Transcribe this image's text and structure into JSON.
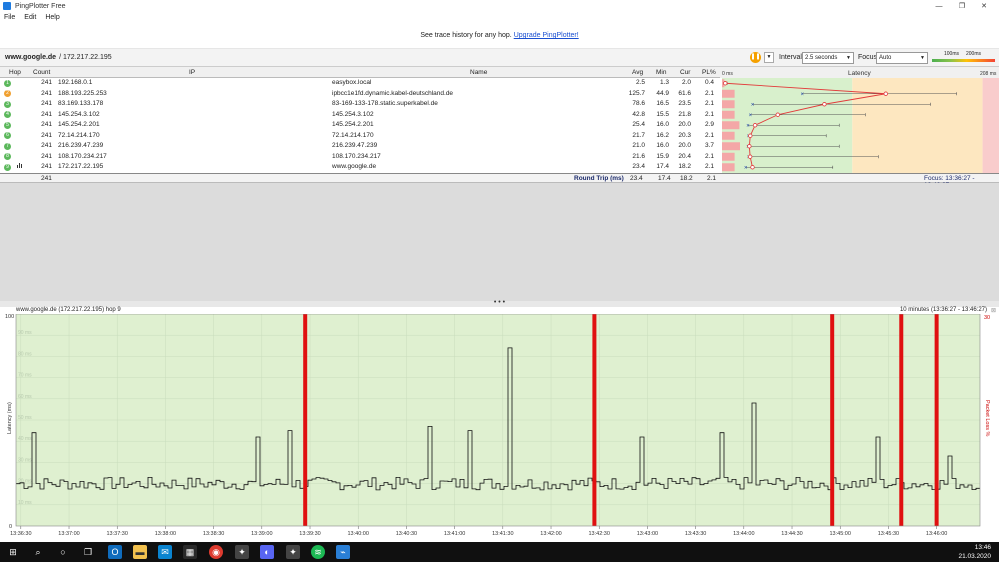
{
  "window": {
    "title": "PingPlotter Free",
    "minimize": "—",
    "maximize": "❐",
    "close": "✕"
  },
  "menu": [
    "File",
    "Edit",
    "Help"
  ],
  "banner": {
    "text": "See trace history for any hop.",
    "link": "Upgrade PingPlotter!"
  },
  "target": {
    "host": "www.google.de",
    "ip": "/ 172.217.22.195"
  },
  "controls": {
    "interval_label": "Interval",
    "interval_value": "2.5 seconds",
    "focus_label": "Focus",
    "focus_value": "Auto",
    "scale_100": "100ms",
    "scale_200": "200ms"
  },
  "table": {
    "headers": {
      "hop": "Hop",
      "count": "Count",
      "ip": "IP",
      "name": "Name",
      "avg": "Avg",
      "min": "Min",
      "cur": "Cur",
      "pl": "PL%",
      "latency": "Latency",
      "lat_min": "0 ms",
      "lat_max": "208 ms"
    },
    "rows": [
      {
        "hop": "1",
        "count": "241",
        "ip": "192.168.0.1",
        "name": "easybox.local",
        "avg": "2.5",
        "min": "1.3",
        "cur": "2.0",
        "pl": "0.4",
        "badge": "green"
      },
      {
        "hop": "2",
        "count": "241",
        "ip": "188.193.225.253",
        "name": "ipbcc1e1fd.dynamic.kabel-deutschland.de",
        "avg": "125.7",
        "min": "44.9",
        "cur": "61.6",
        "pl": "2.1",
        "badge": "orange"
      },
      {
        "hop": "3",
        "count": "241",
        "ip": "83.169.133.178",
        "name": "83-169-133-178.static.superkabel.de",
        "avg": "78.6",
        "min": "16.5",
        "cur": "23.5",
        "pl": "2.1",
        "badge": "green"
      },
      {
        "hop": "4",
        "count": "241",
        "ip": "145.254.3.102",
        "name": "145.254.3.102",
        "avg": "42.8",
        "min": "15.5",
        "cur": "21.8",
        "pl": "2.1",
        "badge": "green"
      },
      {
        "hop": "5",
        "count": "241",
        "ip": "145.254.2.201",
        "name": "145.254.2.201",
        "avg": "25.4",
        "min": "16.0",
        "cur": "20.0",
        "pl": "2.9",
        "badge": "green"
      },
      {
        "hop": "6",
        "count": "241",
        "ip": "72.14.214.170",
        "name": "72.14.214.170",
        "avg": "21.7",
        "min": "16.2",
        "cur": "20.3",
        "pl": "2.1",
        "badge": "green"
      },
      {
        "hop": "7",
        "count": "241",
        "ip": "216.239.47.239",
        "name": "216.239.47.239",
        "avg": "21.0",
        "min": "16.0",
        "cur": "20.0",
        "pl": "3.7",
        "badge": "green"
      },
      {
        "hop": "8",
        "count": "241",
        "ip": "108.170.234.217",
        "name": "108.170.234.217",
        "avg": "21.6",
        "min": "15.9",
        "cur": "20.4",
        "pl": "2.1",
        "badge": "green"
      },
      {
        "hop": "9",
        "count": "241",
        "ip": "172.217.22.195",
        "name": "www.google.de",
        "avg": "23.4",
        "min": "17.4",
        "cur": "18.2",
        "pl": "2.1",
        "badge": "green"
      }
    ],
    "total": {
      "count": "241",
      "label": "Round Trip (ms)",
      "avg": "23.4",
      "min": "17.4",
      "cur": "18.2",
      "pl": "2.1",
      "focus": "Focus: 13:36:27 - 13:46:27"
    }
  },
  "splitter": "• • •",
  "graph": {
    "title": "www.google.de (172.217.22.195) hop 9",
    "range": "10 minutes (13:36:27 - 13:46:27)",
    "close": "⊠"
  },
  "chart_data": {
    "type": "line",
    "ylabel": "Latency (ms)",
    "y2label": "Packet Loss %",
    "ylim": [
      0,
      100
    ],
    "y_ticks": [
      "100",
      "0"
    ],
    "y_faint_ticks": [
      "90 ms",
      "80 ms",
      "70 ms",
      "60 ms",
      "50 ms",
      "40 ms",
      "30 ms",
      "20 ms",
      "10 ms"
    ],
    "y2_top": "30",
    "x_ticks": [
      "13:36:30",
      "13:37:00",
      "13:37:30",
      "13:38:00",
      "13:38:30",
      "13:39:00",
      "13:39:30",
      "13:40:00",
      "13:40:30",
      "13:41:00",
      "13:41:30",
      "13:42:00",
      "13:42:30",
      "13:43:00",
      "13:43:30",
      "13:44:00",
      "13:44:30",
      "13:45:00",
      "13:45:30",
      "13:46:00"
    ],
    "packet_loss_times": [
      "13:39:27",
      "13:42:27",
      "13:44:55",
      "13:45:38",
      "13:46:00"
    ],
    "baseline_ms": 20,
    "spikes": [
      {
        "time": "13:36:38",
        "ms": 44
      },
      {
        "time": "13:38:57",
        "ms": 42
      },
      {
        "time": "13:39:17",
        "ms": 45
      },
      {
        "time": "13:40:45",
        "ms": 47
      },
      {
        "time": "13:41:10",
        "ms": 45
      },
      {
        "time": "13:41:35",
        "ms": 84
      },
      {
        "time": "13:42:57",
        "ms": 42
      },
      {
        "time": "13:43:47",
        "ms": 44
      },
      {
        "time": "13:44:07",
        "ms": 58
      },
      {
        "time": "13:45:25",
        "ms": 42
      },
      {
        "time": "13:46:10",
        "ms": 33
      }
    ]
  },
  "latency_panel": {
    "x_max_ms": 208,
    "avg_ms": [
      2.5,
      125.7,
      78.6,
      42.8,
      25.4,
      21.7,
      21.0,
      21.6,
      23.4
    ],
    "cur_ms": [
      2.0,
      61.6,
      23.5,
      21.8,
      20.0,
      20.3,
      20.0,
      20.4,
      18.2
    ],
    "max_ms": [
      4,
      180,
      160,
      110,
      90,
      80,
      90,
      120,
      85
    ],
    "pl": [
      0.4,
      2.1,
      2.1,
      2.1,
      2.9,
      2.1,
      3.7,
      2.1,
      2.1
    ],
    "colors": {
      "green": "#d8f0cc",
      "yellow": "#fde7c0",
      "red": "#f9cccc",
      "line": "#e23b3b"
    }
  },
  "taskbar": {
    "time": "13:46",
    "date": "21.03.2020"
  }
}
